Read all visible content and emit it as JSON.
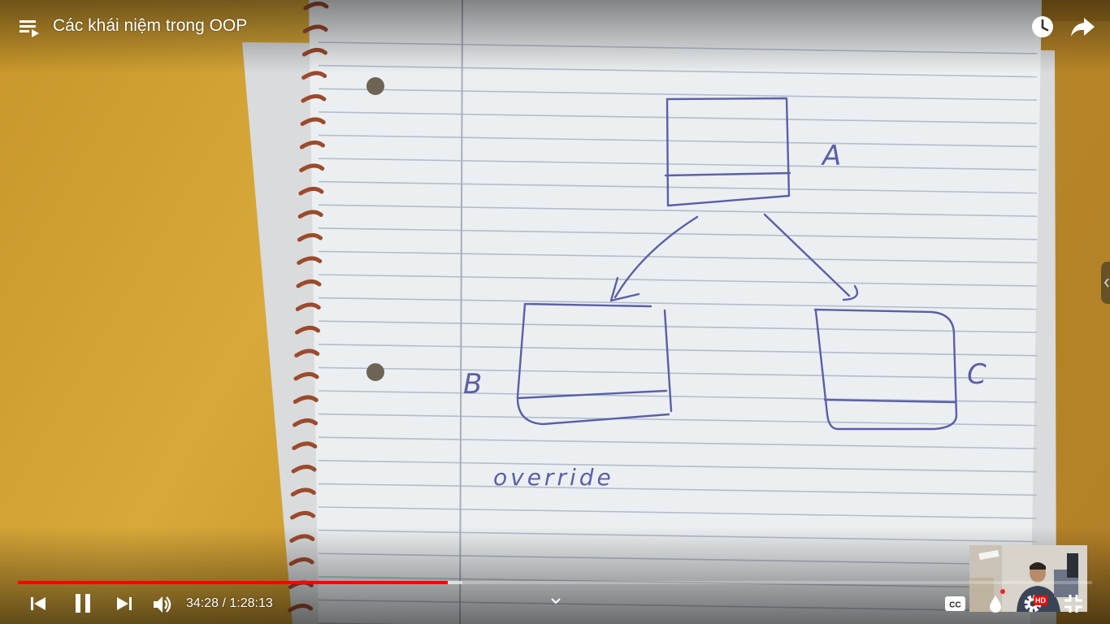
{
  "player": {
    "title": "Các khái niệm trong OOP",
    "time": {
      "current": "34:28",
      "separator": " / ",
      "duration": "1:28:13"
    },
    "progress": {
      "played_fraction": 0.4,
      "buffered_fraction": 0.414
    },
    "hd_badge": "HD",
    "accent_color": "#ff0000"
  },
  "icons": {
    "playlist": "playlist-icon",
    "watch_later": "clock-icon",
    "share": "share-arrow-icon",
    "prev": "previous-icon",
    "pause": "pause-icon",
    "next": "next-icon",
    "volume": "volume-icon",
    "chapters": "chevron-down-icon",
    "subtitles": "cc-icon",
    "autoplay": "autoplay-drop-icon",
    "settings": "gear-icon",
    "exit_fullscreen": "exit-fullscreen-icon",
    "side_panel": "chevron-left-icon"
  },
  "notebook": {
    "labels": {
      "a": "A",
      "b": "B",
      "c": "C"
    },
    "note": "override"
  }
}
